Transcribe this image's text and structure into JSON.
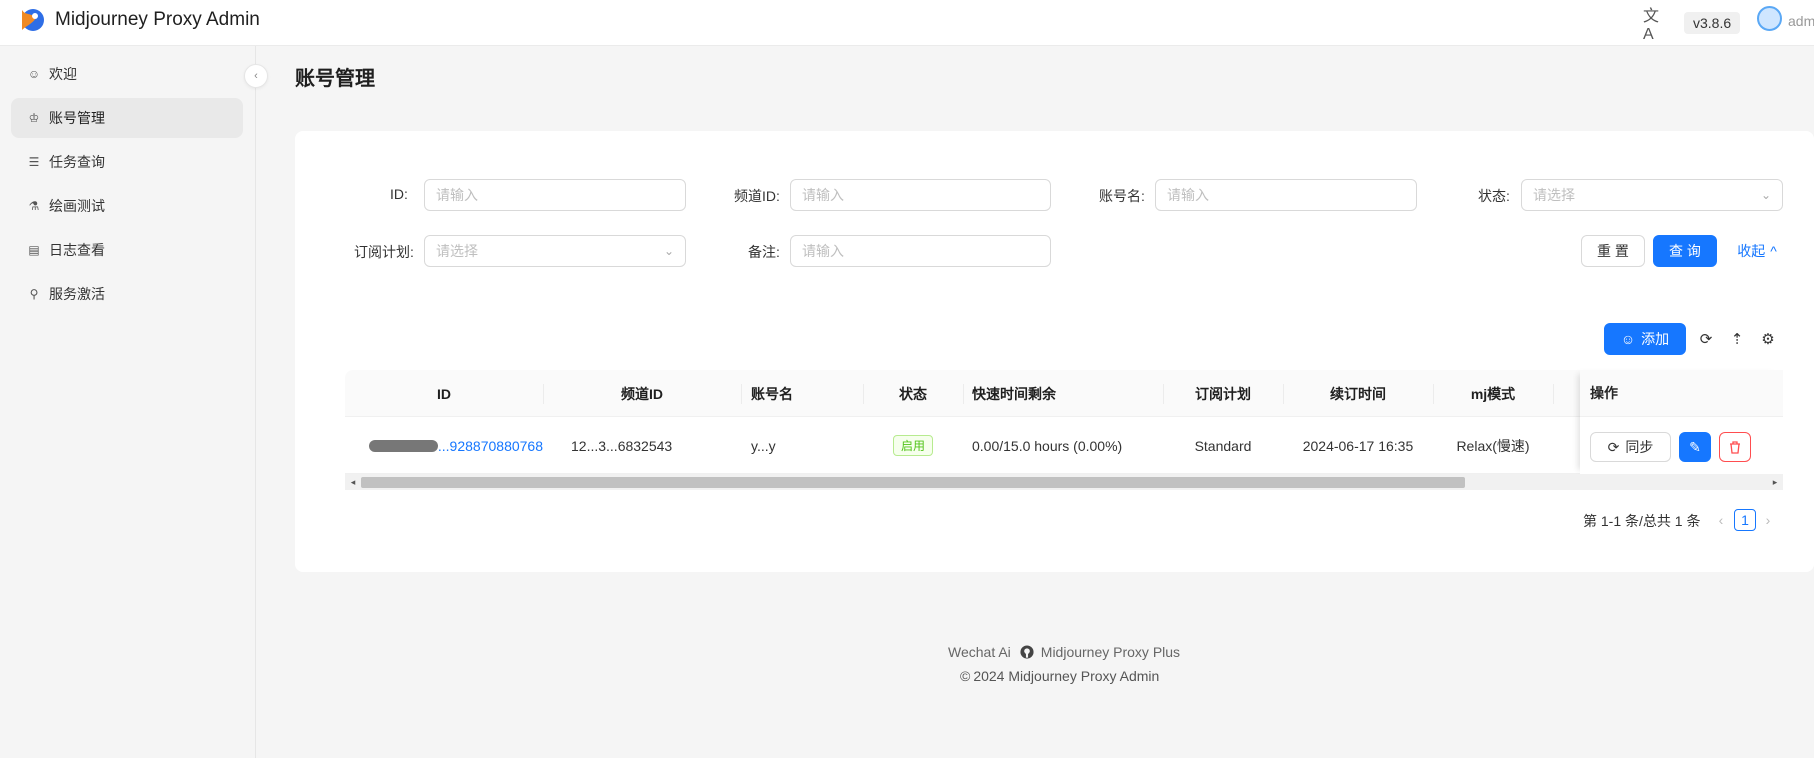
{
  "header": {
    "app_title": "Midjourney Proxy Admin",
    "version": "v3.8.6",
    "username": "adm",
    "icons": [
      "app-logo",
      "translate-icon",
      "avatar"
    ]
  },
  "sidebar": {
    "items": [
      {
        "label": "欢迎",
        "icon": "smile-icon"
      },
      {
        "label": "账号管理",
        "icon": "crown-icon",
        "active": true
      },
      {
        "label": "任务查询",
        "icon": "list-icon"
      },
      {
        "label": "绘画测试",
        "icon": "flask-icon"
      },
      {
        "label": "日志查看",
        "icon": "log-icon"
      },
      {
        "label": "服务激活",
        "icon": "key-icon"
      }
    ]
  },
  "page": {
    "title": "账号管理"
  },
  "filters": {
    "id_label": "ID:",
    "id_placeholder": "请输入",
    "channel_label": "频道ID:",
    "channel_placeholder": "请输入",
    "account_label": "账号名:",
    "account_placeholder": "请输入",
    "status_label": "状态:",
    "status_placeholder": "请选择",
    "plan_label": "订阅计划:",
    "plan_placeholder": "请选择",
    "remark_label": "备注:",
    "remark_placeholder": "请输入",
    "reset_label": "重 置",
    "query_label": "查 询",
    "collapse_label": "收起"
  },
  "toolbar": {
    "add_label": "添加"
  },
  "table": {
    "columns": [
      "ID",
      "频道ID",
      "账号名",
      "状态",
      "快速时间剩余",
      "订阅计划",
      "续订时间",
      "mj模式",
      "操作"
    ],
    "rows": [
      {
        "id_visible": "...928870880768",
        "channel_visible": "12...3...6832543",
        "account_visible": "y...y",
        "status": "启用",
        "fast_time": "0.00/15.0 hours (0.00%)",
        "plan": "Standard",
        "renew_time": "2024-06-17 16:35",
        "mode": "Relax(慢速)",
        "sync_label": "同步"
      }
    ]
  },
  "pagination": {
    "total": "第 1-1 条/总共 1 条",
    "current": "1"
  },
  "footer": {
    "link1": "Wechat Ai",
    "link2": "Midjourney Proxy Plus",
    "copyright": "2024 Midjourney Proxy Admin"
  },
  "colors": {
    "primary": "#1677ff",
    "danger": "#ff4d4f",
    "success": "#52c41a"
  }
}
